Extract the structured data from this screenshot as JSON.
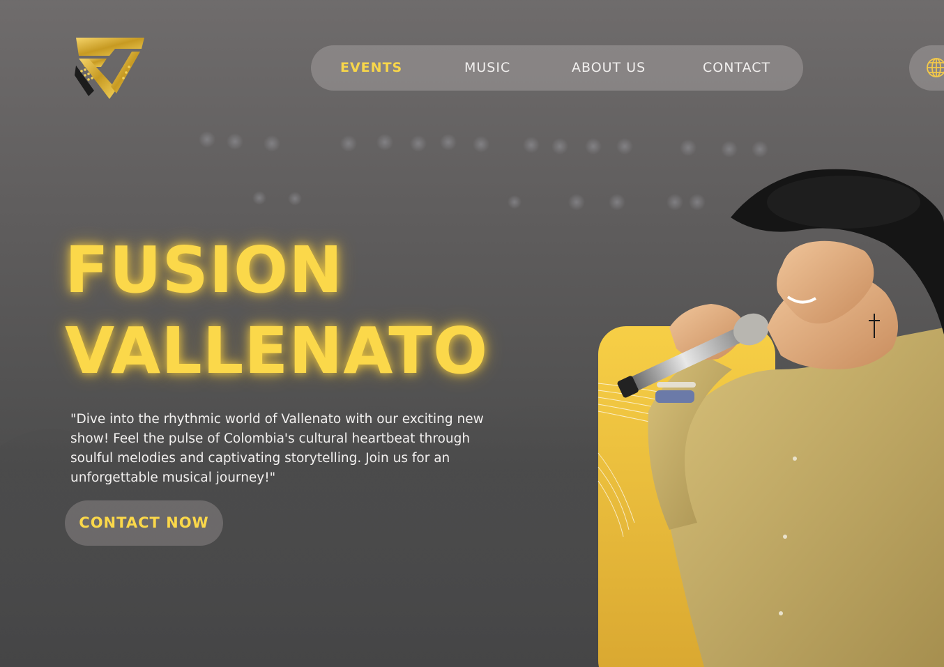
{
  "nav": {
    "items": [
      {
        "label": "EVENTS",
        "active": true
      },
      {
        "label": "MUSIC",
        "active": false
      },
      {
        "label": "ABOUT US",
        "active": false
      },
      {
        "label": "CONTACT",
        "active": false
      }
    ]
  },
  "language": {
    "icon": "globe-icon"
  },
  "logo": {
    "icon": "fusion-vallenato-shield-logo"
  },
  "hero": {
    "title_line1": "FUSION",
    "title_line2": "VALLENATO",
    "description": "\"Dive into the rhythmic world of Vallenato with our exciting new show! Feel the pulse of Colombia's cultural heartbeat through soulful melodies and captivating storytelling. Join us for an unforgettable musical journey!\"",
    "cta_label": "CONTACT NOW"
  },
  "colors": {
    "accent": "#fbd84a",
    "nav_text": "#f1efee",
    "background": "#5e5c5c",
    "panel": "#f2c13d"
  }
}
